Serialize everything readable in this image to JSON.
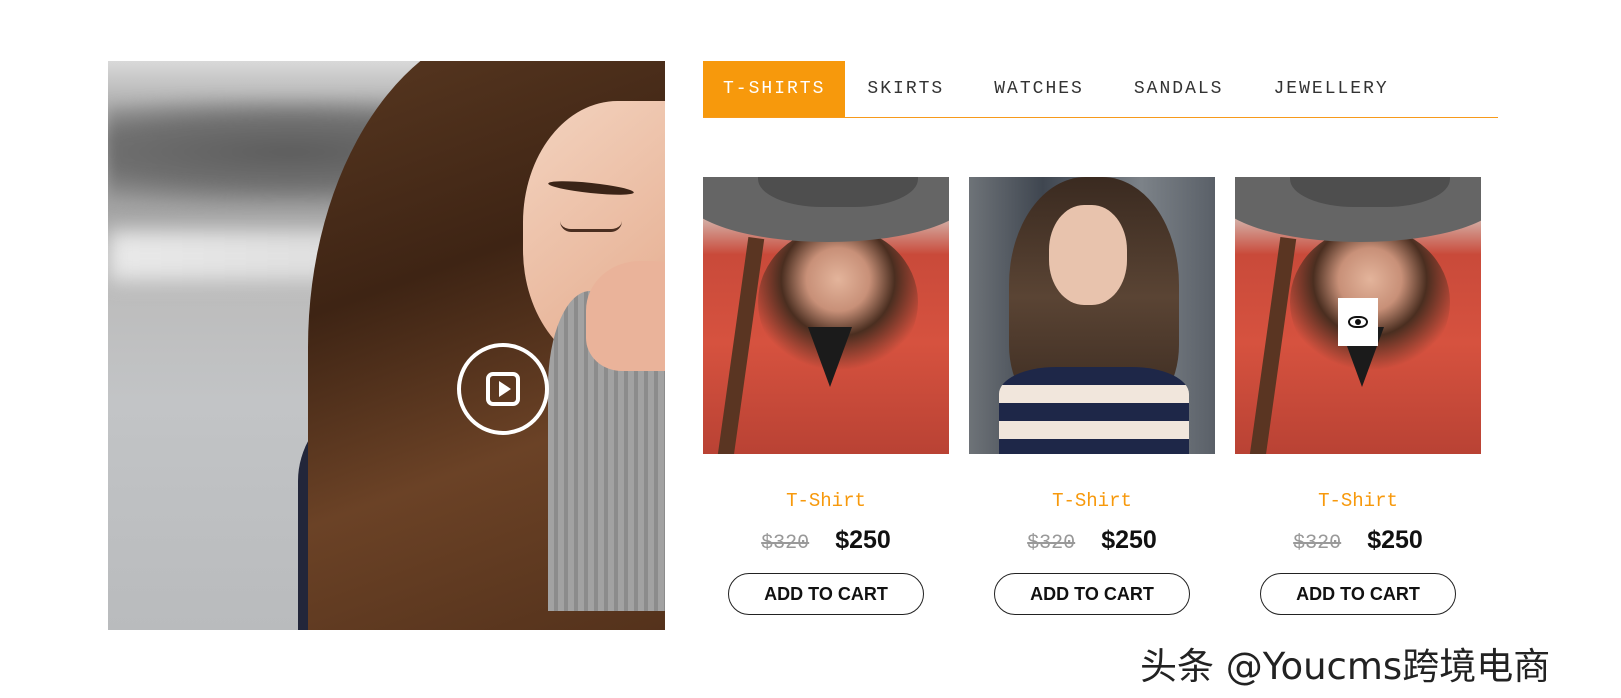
{
  "hero": {
    "play_icon": "play-circle-icon"
  },
  "tabs": [
    {
      "label": "T-SHIRTS",
      "active": true
    },
    {
      "label": "SKIRTS",
      "active": false
    },
    {
      "label": "WATCHES",
      "active": false
    },
    {
      "label": "SANDALS",
      "active": false
    },
    {
      "label": "JEWELLERY",
      "active": false
    }
  ],
  "products": [
    {
      "name": "T-Shirt",
      "old_price": "$320",
      "price": "$250",
      "button": "ADD TO CART"
    },
    {
      "name": "T-Shirt",
      "old_price": "$320",
      "price": "$250",
      "button": "ADD TO CART"
    },
    {
      "name": "T-Shirt",
      "old_price": "$320",
      "price": "$250",
      "button": "ADD TO CART",
      "quick_view_icon": "eye-icon"
    }
  ],
  "colors": {
    "accent": "#f7990c",
    "text": "#111111",
    "muted": "#999999"
  },
  "watermark": "头条 @Youcms跨境电商"
}
